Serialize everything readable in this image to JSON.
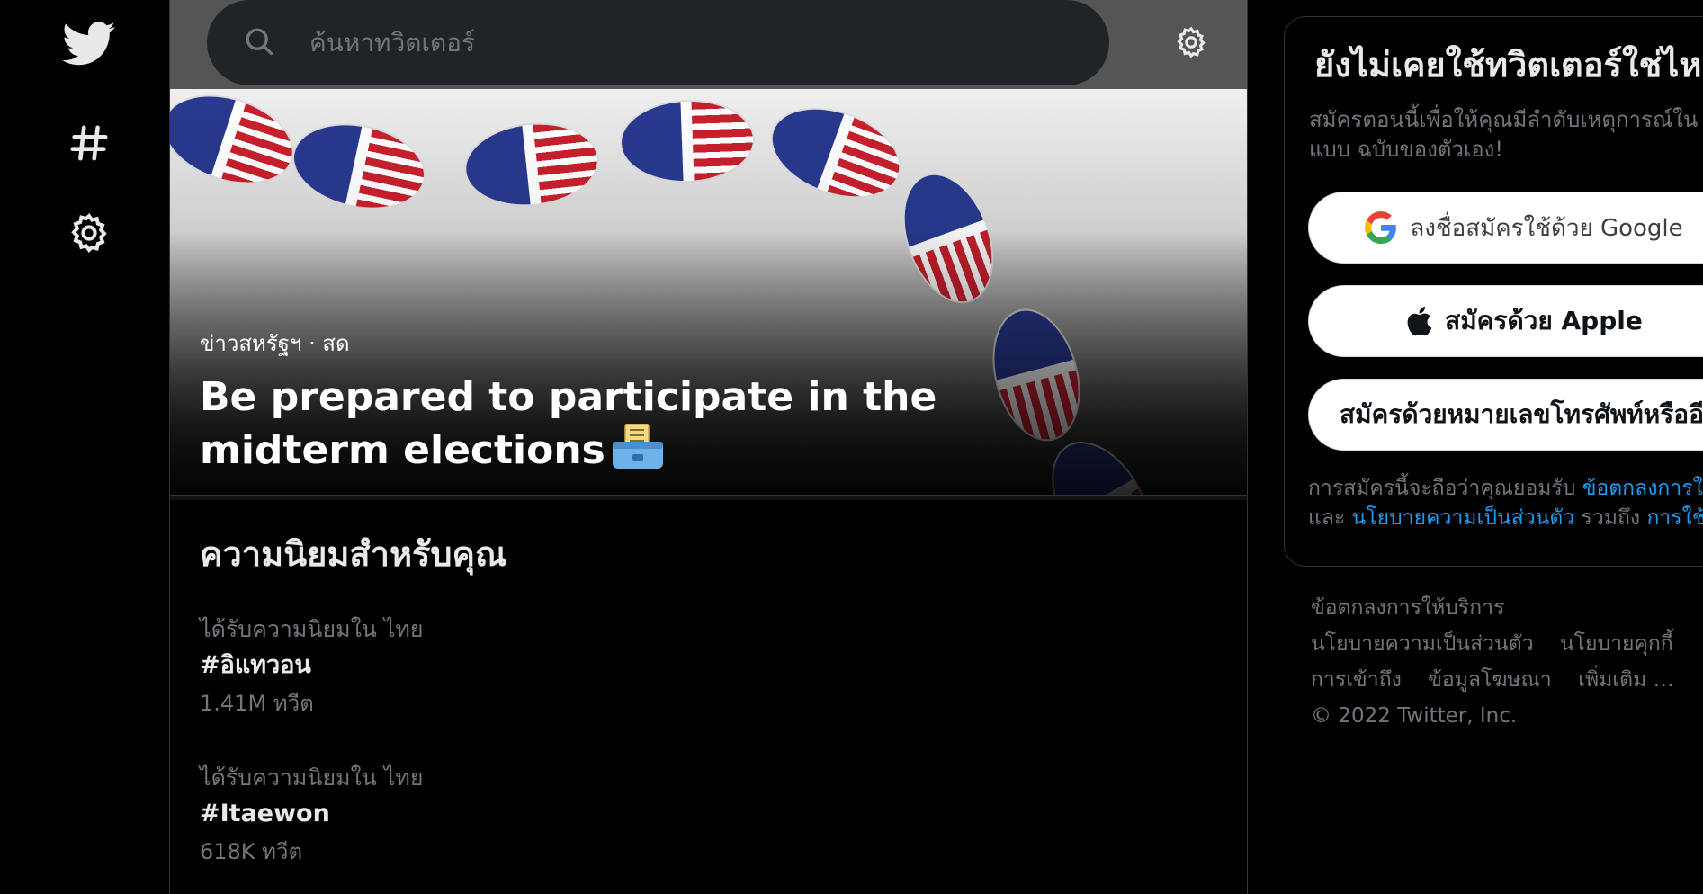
{
  "search": {
    "placeholder": "ค้นหาทวิตเตอร์"
  },
  "nav": {
    "items": [
      {
        "icon": "twitter-bird-icon"
      },
      {
        "icon": "hashtag-icon"
      },
      {
        "icon": "gear-icon"
      }
    ]
  },
  "hero": {
    "meta": "ข่าวสหรัฐฯ · สด",
    "title": "Be prepared to participate in the midterm elections",
    "image_alt": "I VOTED stickers"
  },
  "trends": {
    "title": "ความนิยมสำหรับคุณ",
    "items": [
      {
        "context": "ได้รับความนิยมใน ไทย",
        "name": "#อิแทวอน",
        "count": "1.41M ทวีต"
      },
      {
        "context": "ได้รับความนิยมใน ไทย",
        "name": "#Itaewon",
        "count": "618K ทวีต"
      }
    ]
  },
  "signup": {
    "title": "ยังไม่เคยใช้ทวิตเตอร์ใช่ไหม",
    "subtitle": "สมัครตอนนี้เพื่อให้คุณมีลำดับเหตุการณ์ในแบบ ฉบับของตัวเอง!",
    "google_label": "ลงชื่อสมัครใช้ด้วย Google",
    "apple_label": "สมัครด้วย Apple",
    "phone_label": "สมัครด้วยหมายเลขโทรศัพท์หรืออีเมล",
    "legal_prefix": "การสมัครนี้จะถือว่าคุณยอมรับ",
    "legal_terms": "ข้อตกลงการให้บริการ",
    "legal_and": "และ",
    "legal_privacy": "นโยบายความเป็นส่วนตัว",
    "legal_including": "รวมถึง",
    "legal_cookies": "การใช้คุกกี้"
  },
  "footer": {
    "terms": "ข้อตกลงการให้บริการ",
    "privacy": "นโยบายความเป็นส่วนตัว",
    "cookies": "นโยบายคุกกี้",
    "accessibility": "การเข้าถึง",
    "ads_info": "ข้อมูลโฆษณา",
    "more": "เพิ่มเติม …",
    "copyright": "© 2022 Twitter, Inc."
  }
}
